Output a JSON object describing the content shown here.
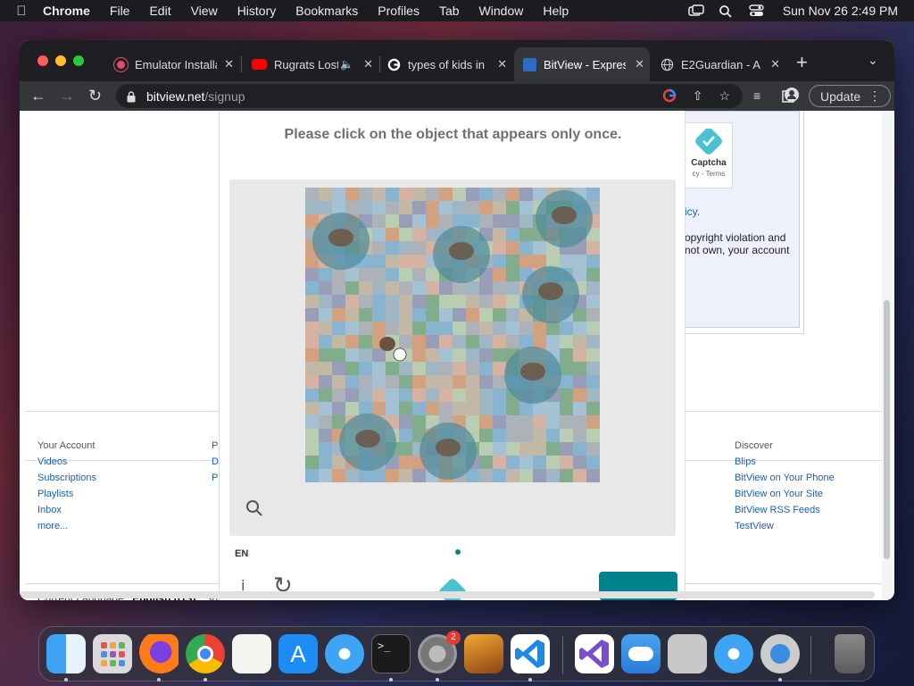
{
  "menubar": {
    "app_name": "Chrome",
    "menus": [
      "File",
      "Edit",
      "View",
      "History",
      "Bookmarks",
      "Profiles",
      "Tab",
      "Window",
      "Help"
    ],
    "clock": "Sun Nov 26  2:49 PM"
  },
  "tabs": [
    {
      "title": "Emulator Installation",
      "favicon": "emulator-icon"
    },
    {
      "title": "Rugrats Lost",
      "favicon": "youtube-icon"
    },
    {
      "title": "types of kids in",
      "favicon": "google-icon"
    },
    {
      "title": "BitView - Express",
      "favicon": "bitview-icon"
    },
    {
      "title": "E2Guardian - A",
      "favicon": "globe-icon"
    }
  ],
  "toolbar": {
    "url_host": "bitview.net",
    "url_path": "/signup",
    "update_label": "Update"
  },
  "right_box": {
    "captcha_label": "Captcha",
    "captcha_terms": "cy - Terms",
    "policy_link": "icy.",
    "copyright_line1": "opyright violation and",
    "copyright_line2": "not own, your account"
  },
  "footer": {
    "col1": {
      "heading": "Your Account",
      "links": [
        "Videos",
        "Subscriptions",
        "Playlists",
        "Inbox",
        "more..."
      ]
    },
    "col2": {
      "heading": "P",
      "links": [
        "D",
        "P"
      ]
    },
    "col3": {
      "heading": "Discover",
      "links": [
        "Blips",
        "BitView on Your Phone",
        "BitView on Your Site",
        "BitView RSS Feeds",
        "TestView"
      ]
    },
    "language_label": "Current Language:",
    "language_value": "English (US)",
    "language_show": "Sh"
  },
  "captcha": {
    "prompt": "Please click on the object that appears only once.",
    "language": "EN"
  },
  "colors": {
    "teal": "#00838f",
    "link": "#1a5fb4"
  },
  "dock": {
    "apps": [
      "finder-icon",
      "launchpad-icon",
      "firefox-icon",
      "chrome-icon",
      "textedit-icon",
      "app-store-icon",
      "safari-icon",
      "terminal-icon",
      "system-settings-icon",
      "garageband-icon",
      "vscode-icon",
      "visual-studio-icon",
      "weather-icon",
      "preview-icon",
      "safari-icon",
      "quicktime-icon",
      "trash-icon"
    ],
    "settings_badge": "2"
  }
}
